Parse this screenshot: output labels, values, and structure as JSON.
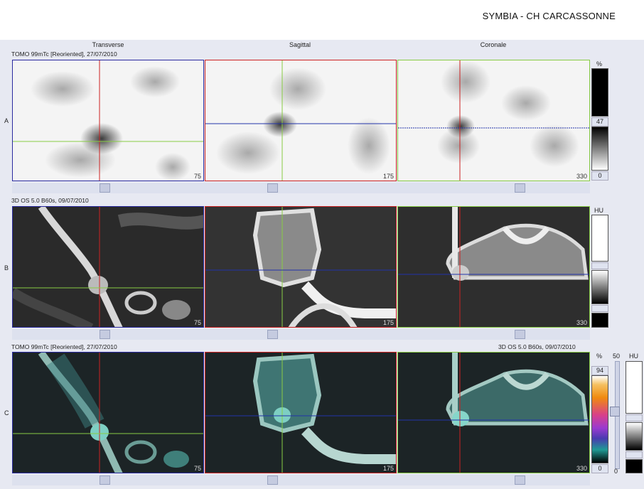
{
  "header": {
    "site": "SYMBIA - CH CARCASSONNE"
  },
  "columns": [
    "Transverse",
    "Sagittal",
    "Coronale"
  ],
  "rows": {
    "a": {
      "label": "A",
      "series": "TOMO 99mTc [Reoriented], 27/07/2010",
      "slices": [
        "75",
        "175",
        "330"
      ]
    },
    "b": {
      "label": "B",
      "series": "3D  OS  5.0  B60s, 09/07/2010",
      "slices": [
        "75",
        "175",
        "330"
      ]
    },
    "c": {
      "label": "C",
      "series_left": "TOMO 99mTc [Reoriented], 27/07/2010",
      "series_right": "3D  OS  5.0  B60s, 09/07/2010",
      "slices": [
        "75",
        "175",
        "330"
      ]
    }
  },
  "colorbars": {
    "a": {
      "unit": "%",
      "value": "47",
      "min": "0"
    },
    "b": {
      "unit": "HU"
    },
    "c": {
      "unit": "%",
      "value": "94",
      "min": "0",
      "blend": "50",
      "blend_min": "0",
      "ct_unit": "HU"
    }
  },
  "colors": {
    "background": "#e7e9f2",
    "cross_red": "#cc2222",
    "cross_blue": "#2233aa",
    "cross_green": "#88cc44"
  }
}
